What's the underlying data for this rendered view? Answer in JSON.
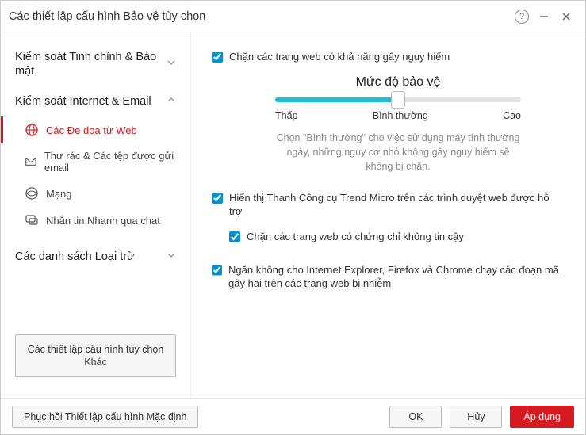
{
  "window": {
    "title": "Các thiết lập cấu hình Bảo vệ tùy chọn"
  },
  "sidebar": {
    "groups": [
      {
        "label": "Kiểm soát Tinh chỉnh & Bảo mật",
        "expanded": false
      },
      {
        "label": "Kiểm soát Internet & Email",
        "expanded": true
      },
      {
        "label": "Các danh sách Loại trừ",
        "expanded": false
      }
    ],
    "items": [
      {
        "label": "Các Đe dọa từ Web",
        "active": true
      },
      {
        "label": "Thư rác & Các tệp được gửi email",
        "active": false
      },
      {
        "label": "Mạng",
        "active": false
      },
      {
        "label": "Nhắn tin Nhanh qua chat",
        "active": false
      }
    ],
    "other_button": "Các thiết lập cấu hình tùy chọn Khác"
  },
  "content": {
    "block_dangerous": {
      "label": "Chặn các trang web có khả năng gây nguy hiểm",
      "checked": true
    },
    "slider": {
      "title": "Mức độ bảo vệ",
      "low": "Thấp",
      "mid": "Bình thường",
      "high": "Cao",
      "hint": "Chọn \"Bình thường\" cho việc sử dụng máy tính thường ngày, những nguy cơ nhỏ không gây nguy hiểm sẽ không bị chặn."
    },
    "toolbar": {
      "label": "Hiển thị Thanh Công cụ Trend Micro trên các trình duyệt web được hỗ trợ",
      "checked": true
    },
    "block_cert": {
      "label": "Chặn các trang web có chứng chỉ không tin cậy",
      "checked": true
    },
    "block_scripts": {
      "label": "Ngăn không cho Internet Explorer, Firefox và Chrome chạy các đoạn mã gây hại trên các trang web bị nhiễm",
      "checked": true
    }
  },
  "footer": {
    "restore": "Phục hồi Thiết lập cấu hình Mặc định",
    "ok": "OK",
    "cancel": "Hủy",
    "apply": "Áp dụng"
  }
}
